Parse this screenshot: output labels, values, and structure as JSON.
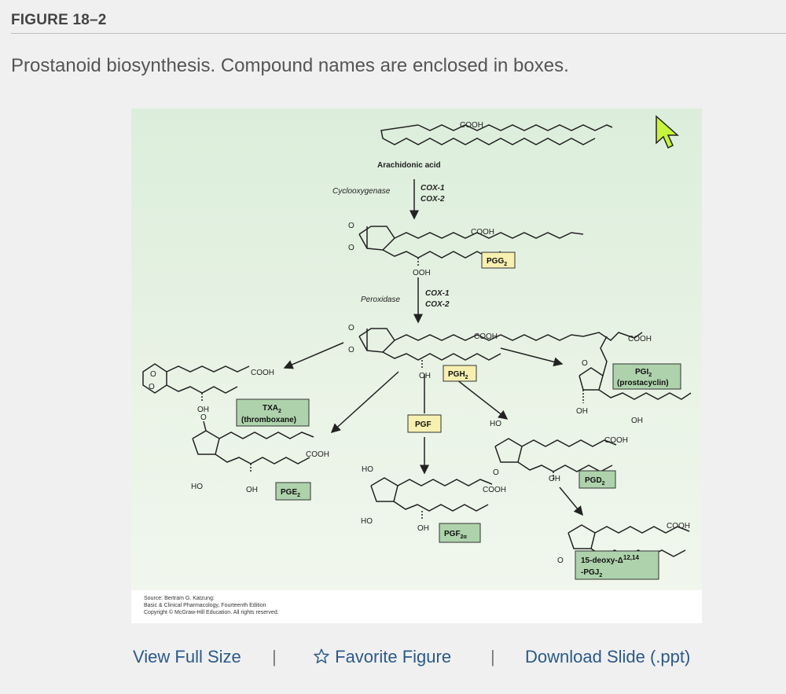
{
  "figure": {
    "label": "FIGURE 18–2",
    "caption": "Prostanoid biosynthesis. Compound names are enclosed in boxes."
  },
  "diagram": {
    "arachidonic_acid": "Arachidonic acid",
    "cyclooxygenase": "Cyclooxygenase",
    "peroxidase": "Peroxidase",
    "cox1": "COX-1",
    "cox2": "COX-2",
    "cooh": "COOH",
    "ooh": "OOH",
    "oh": "OH",
    "ho": "HO",
    "o": "O",
    "pgg2_base": "PGG",
    "pgg2_sub": "2",
    "pgh2_base": "PGH",
    "pgh2_sub": "2",
    "txa2_base": "TXA",
    "txa2_sub": "2",
    "txa2_name": "(thromboxane)",
    "pgi2_base": "PGI",
    "pgi2_sub": "2",
    "pgi2_name": "(prostacyclin)",
    "pge2_base": "PGE",
    "pge2_sub": "2",
    "pgf": "PGF",
    "pgf2a_base": "PGF",
    "pgf2a_sub": "2α",
    "pgd2_base": "PGD",
    "pgd2_sub": "2",
    "deoxy_line1": "15-deoxy-Δ",
    "deoxy_sup": "12,14",
    "deoxy_line2": "-PGJ",
    "deoxy_sub": "2",
    "colors": {
      "box_yellow": "#f7f0b0",
      "box_green": "#aed3ac"
    }
  },
  "source": {
    "line1": "Source: Bertram G. Katzung:",
    "line2": "Basic & Clinical Pharmacology, Fourteenth Edition",
    "line3": "Copyright © McGraw-Hill Education. All rights reserved."
  },
  "actions": {
    "view_full_size": "View Full Size",
    "favorite_figure": "Favorite Figure",
    "download_slide": "Download Slide (.ppt)",
    "separator": "|"
  },
  "icons": {
    "favorite": "star-outline-icon",
    "cursor": "mouse-pointer-icon"
  }
}
